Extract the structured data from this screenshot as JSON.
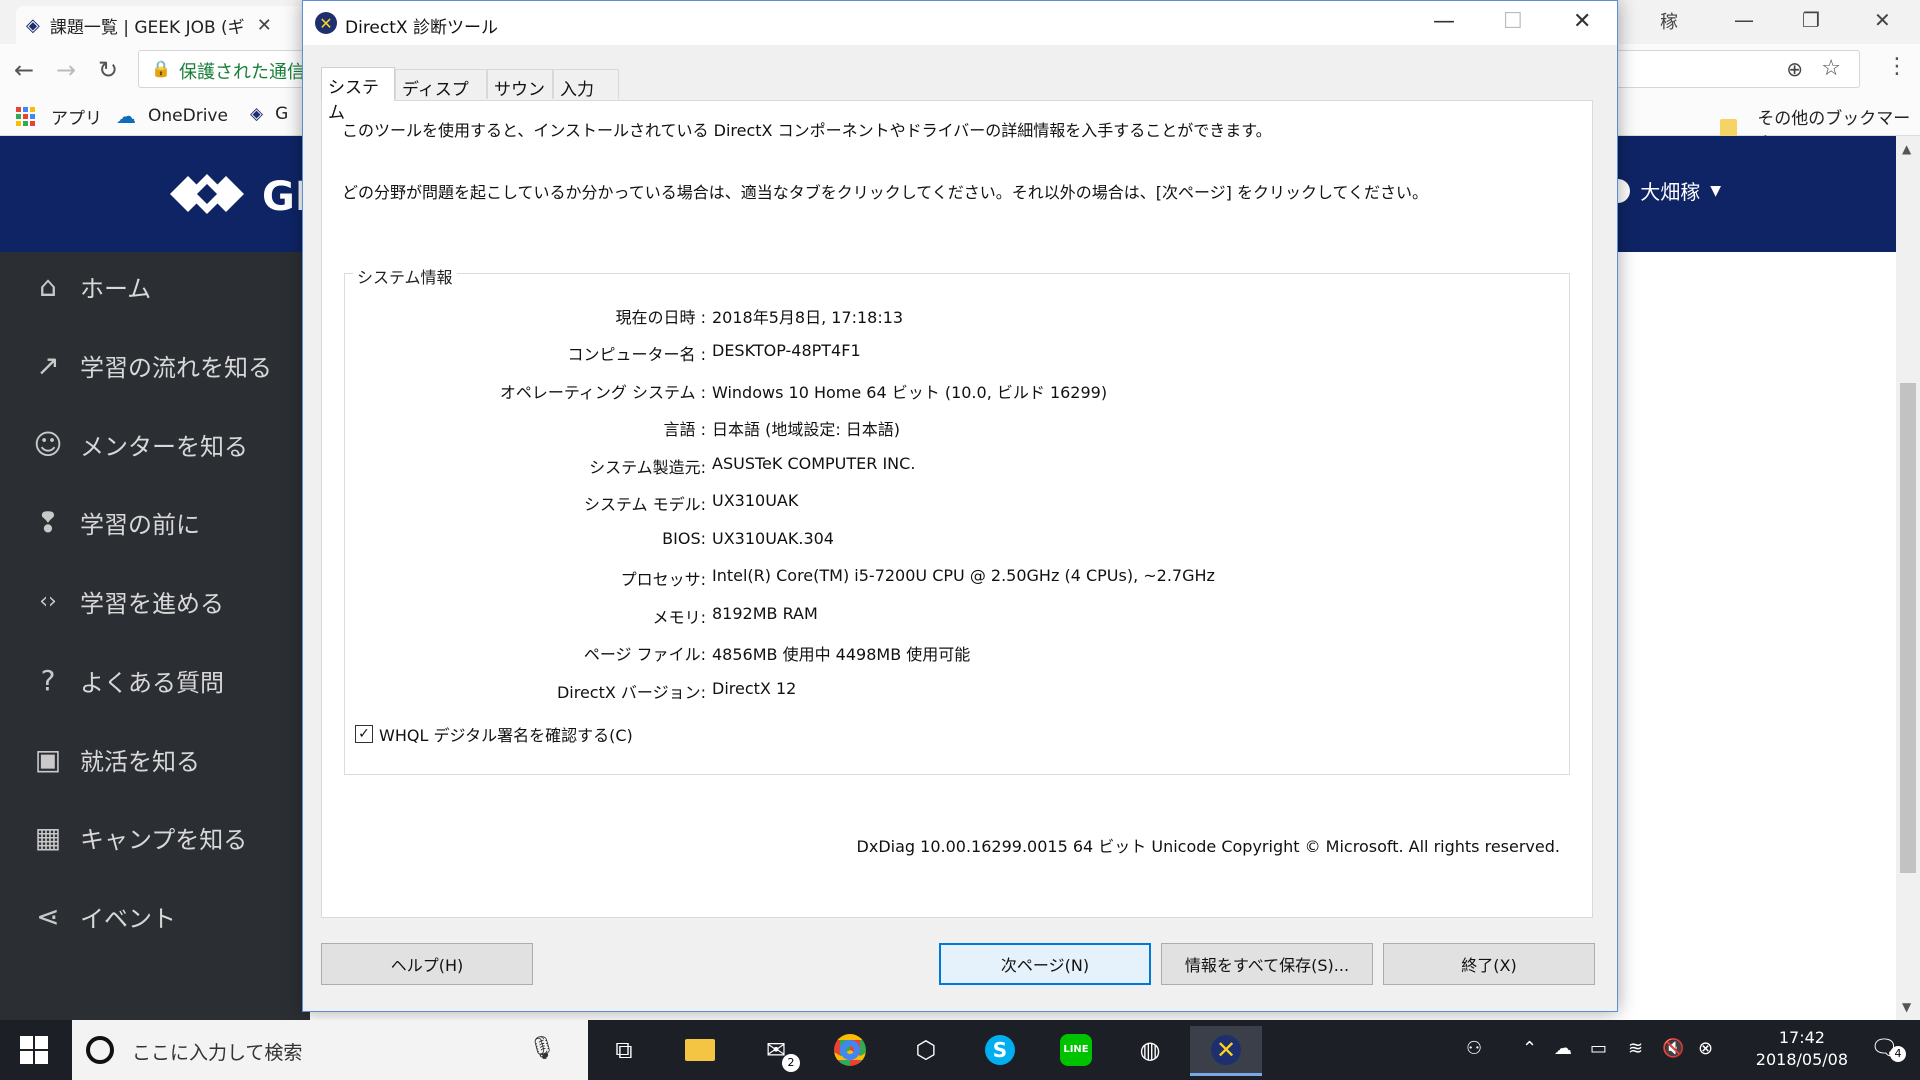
{
  "browser": {
    "tab_title": "課題一覧 | GEEK JOB (ギ",
    "secure_text": "保護された通信",
    "bookmarks": {
      "apps": "アプリ",
      "onedrive": "OneDrive",
      "g": "G",
      "other": "その他のブックマーク"
    },
    "user_name_partial": "稼"
  },
  "site": {
    "brand": "GE",
    "user_name": "大畑稼",
    "menu": [
      {
        "label": "ホーム",
        "icon": "home-icon"
      },
      {
        "label": "学習の流れを知る",
        "icon": "trend-icon"
      },
      {
        "label": "メンターを知る",
        "icon": "smiley-icon"
      },
      {
        "label": "学習の前に",
        "icon": "alert-bubble-icon"
      },
      {
        "label": "学習を進める",
        "icon": "code-icon"
      },
      {
        "label": "よくある質問",
        "icon": "question-icon"
      },
      {
        "label": "就活を知る",
        "icon": "briefcase-icon"
      },
      {
        "label": "キャンプを知る",
        "icon": "building-icon"
      },
      {
        "label": "イベント",
        "icon": "share-icon"
      }
    ]
  },
  "dialog": {
    "title": "DirectX 診断ツール",
    "tabs": [
      "システム",
      "ディスプレイ",
      "サウンド",
      "入力"
    ],
    "intro1": "このツールを使用すると、インストールされている DirectX コンポーネントやドライバーの詳細情報を入手することができます。",
    "intro2": "どの分野が問題を起こしているか分かっている場合は、適当なタブをクリックしてください。それ以外の場合は、[次ページ] をクリックしてください。",
    "group_label": "システム情報",
    "rows": [
      {
        "key": "現在の日時 :",
        "value": "2018年5月8日, 17:18:13"
      },
      {
        "key": "コンピューター名 :",
        "value": "DESKTOP-48PT4F1"
      },
      {
        "key": "オペレーティング システム :",
        "value": "Windows 10 Home 64 ビット (10.0, ビルド 16299)"
      },
      {
        "key": "言語 :",
        "value": "日本語 (地域設定: 日本語)"
      },
      {
        "key": "システム製造元:",
        "value": "ASUSTeK COMPUTER INC."
      },
      {
        "key": "システム モデル:",
        "value": "UX310UAK"
      },
      {
        "key": "BIOS:",
        "value": "UX310UAK.304"
      },
      {
        "key": "プロセッサ:",
        "value": "Intel(R) Core(TM) i5-7200U CPU @ 2.50GHz (4 CPUs), ~2.7GHz"
      },
      {
        "key": "メモリ:",
        "value": "8192MB RAM"
      },
      {
        "key": "ページ ファイル:",
        "value": "4856MB 使用中 4498MB 使用可能"
      },
      {
        "key": "DirectX バージョン:",
        "value": "DirectX 12"
      }
    ],
    "whql_label": "WHQL デジタル署名を確認する(C)",
    "whql_checked": true,
    "version_text": "DxDiag 10.00.16299.0015 64 ビット Unicode  Copyright © Microsoft. All rights reserved.",
    "buttons": {
      "help": "ヘルプ(H)",
      "next": "次ページ(N)",
      "save": "情報をすべて保存(S)...",
      "exit": "終了(X)"
    }
  },
  "taskbar": {
    "search_placeholder": "ここに入力して検索",
    "mail_badge": "2",
    "time": "17:42",
    "date": "2018/05/08",
    "notif_count": "4"
  }
}
